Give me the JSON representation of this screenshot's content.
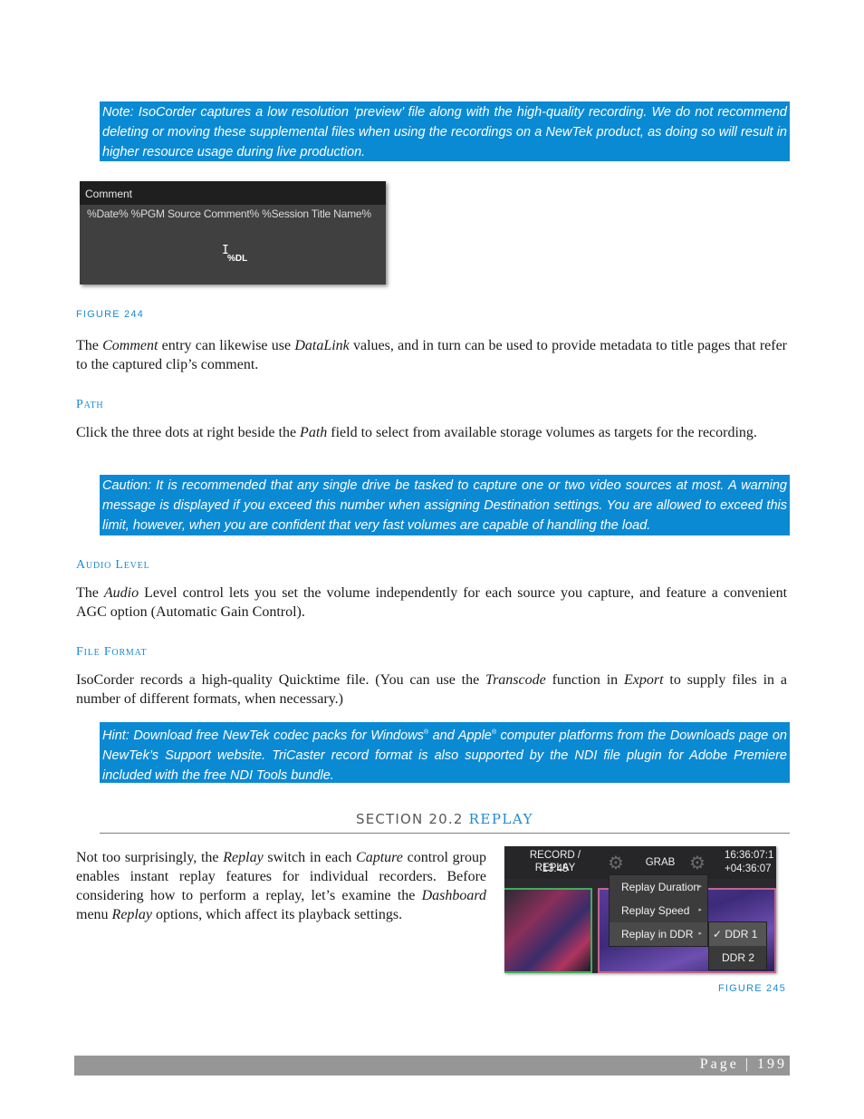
{
  "notes": {
    "note1": "Note: IsoCorder captures a low resolution ‘preview’ file along with the high-quality recording.  We do not recommend deleting or moving these supplemental files when using the recordings on a NewTek product, as doing so will result in higher resource usage during live production.",
    "caution": "Caution: It is recommended that any single drive be tasked to capture one or two video sources at most. A warning message is displayed if you exceed this number when assigning Destination settings.  You are allowed to exceed this limit, however, when you are confident that very fast volumes are capable of handling the load.",
    "hint_part1": "Hint: Download free NewTek codec packs for Windows",
    "hint_reg1": "®",
    "hint_part2": " and Apple",
    "hint_reg2": "®",
    "hint_part3": " computer platforms from the Downloads page on NewTek’s Support website.  TriCaster record format is also supported by the NDI file plugin for Adobe Premiere included with the free NDI Tools bundle."
  },
  "figure244": {
    "header": "Comment",
    "value": "%Date% %PGM Source Comment% %Session Title Name%",
    "cursor_badge": "%DL",
    "caption": "FIGURE 244"
  },
  "paragraphs": {
    "comment_p1": "The ",
    "comment_i1": "Comment",
    "comment_p2": " entry can likewise use ",
    "comment_i2": "DataLink",
    "comment_p3": " values, and in turn can be used to provide metadata to title pages that refer to the captured clip’s comment.",
    "path_heading": "Path",
    "path_p1": "Click the three dots at right beside the ",
    "path_i1": "Path",
    "path_p2": " field to select from available storage volumes as targets for the recording.",
    "audio_heading": "Audio Level",
    "audio_p1": "The ",
    "audio_i1": "Audio",
    "audio_p2": " Level control lets you set the volume independently for each source you capture, and feature a convenient AGC option (Automatic Gain Control).",
    "format_heading": "File Format",
    "format_p1": "IsoCorder records a high-quality Quicktime file.  (You can use the ",
    "format_i1": "Transcode",
    "format_p2": " function in ",
    "format_i2": "Export",
    "format_p3": " to supply files in a number of different formats, when necessary.)",
    "replay_p1": "Not too surprisingly, the ",
    "replay_i1": "Replay",
    "replay_p2": " switch in each ",
    "replay_i2": "Capture",
    "replay_p3": " control group enables instant replay features for individual recorders. Before considering how to perform a replay, let’s examine the ",
    "replay_i3": "Dashboard",
    "replay_p4": " menu ",
    "replay_i4": "Replay",
    "replay_p5": " options, which affect its playback settings."
  },
  "section": {
    "prefix": "SECTION 20.2 ",
    "title": "REPLAY"
  },
  "figure245": {
    "record_label": "RECORD / REPLAY",
    "record_time": "13:45",
    "grab_label": "GRAB",
    "clock": "16:36:07:1",
    "elapsed": "+04:36:07",
    "menu_items": [
      "Replay Duration",
      "Replay Speed",
      "Replay in DDR"
    ],
    "submenu_items": [
      "✓ DDR 1",
      "DDR 2"
    ],
    "caption": "FIGURE 245"
  },
  "footer": {
    "page_label": "Page | 199"
  }
}
